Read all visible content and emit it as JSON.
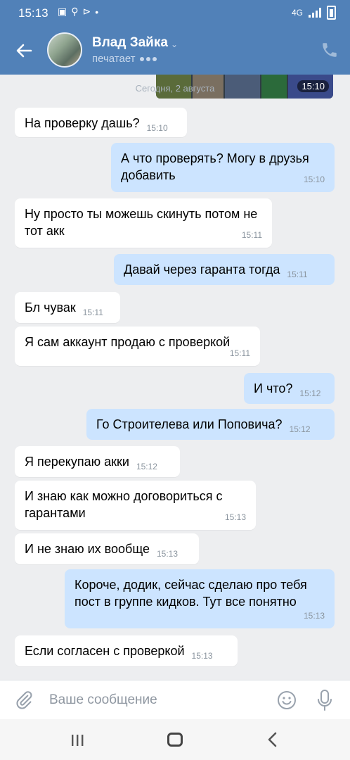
{
  "status_bar": {
    "time": "15:13",
    "network": "4G"
  },
  "header": {
    "contact_name": "Влад Зайка",
    "status": "печатает"
  },
  "chat": {
    "date_separator": "Сегодня, 2 августа",
    "photo_time": "15:10",
    "messages": [
      {
        "dir": "in",
        "text": "На проверку дашь?",
        "time": "15:10"
      },
      {
        "dir": "out",
        "text": "А что проверять? Могу в друзья добавить",
        "time": "15:10"
      },
      {
        "dir": "in",
        "text": "Ну просто ты можешь скинуть потом не тот акк",
        "time": "15:11"
      },
      {
        "dir": "out",
        "text": "Давай через гаранта тогда",
        "time": "15:11"
      },
      {
        "dir": "in",
        "text": "Бл чувак",
        "time": "15:11"
      },
      {
        "dir": "in",
        "text": "Я сам аккаунт продаю с проверкой",
        "time": "15:11"
      },
      {
        "dir": "out",
        "text": "И что?",
        "time": "15:12"
      },
      {
        "dir": "out",
        "text": "Го Строителева или Поповича?",
        "time": "15:12"
      },
      {
        "dir": "in",
        "text": "Я перекупаю акки",
        "time": "15:12"
      },
      {
        "dir": "in",
        "text": "И знаю как можно договориться с гарантами",
        "time": "15:13"
      },
      {
        "dir": "in",
        "text": "И не знаю их вообще",
        "time": "15:13"
      },
      {
        "dir": "out",
        "text": "Короче, додик, сейчас сделаю про тебя пост в группе кидков. Тут все понятно",
        "time": "15:13"
      },
      {
        "dir": "in",
        "text": "Если согласен с проверкой",
        "time": "15:13"
      }
    ]
  },
  "composer": {
    "placeholder": "Ваше сообщение"
  },
  "icons": {
    "back": "arrow-left-icon",
    "phone": "phone-icon",
    "attach": "paperclip-icon",
    "emoji": "smile-icon",
    "mic": "microphone-icon"
  },
  "colors": {
    "header": "#5181b8",
    "incoming": "#ffffff",
    "outgoing": "#cce4ff",
    "background": "#edeef0"
  }
}
